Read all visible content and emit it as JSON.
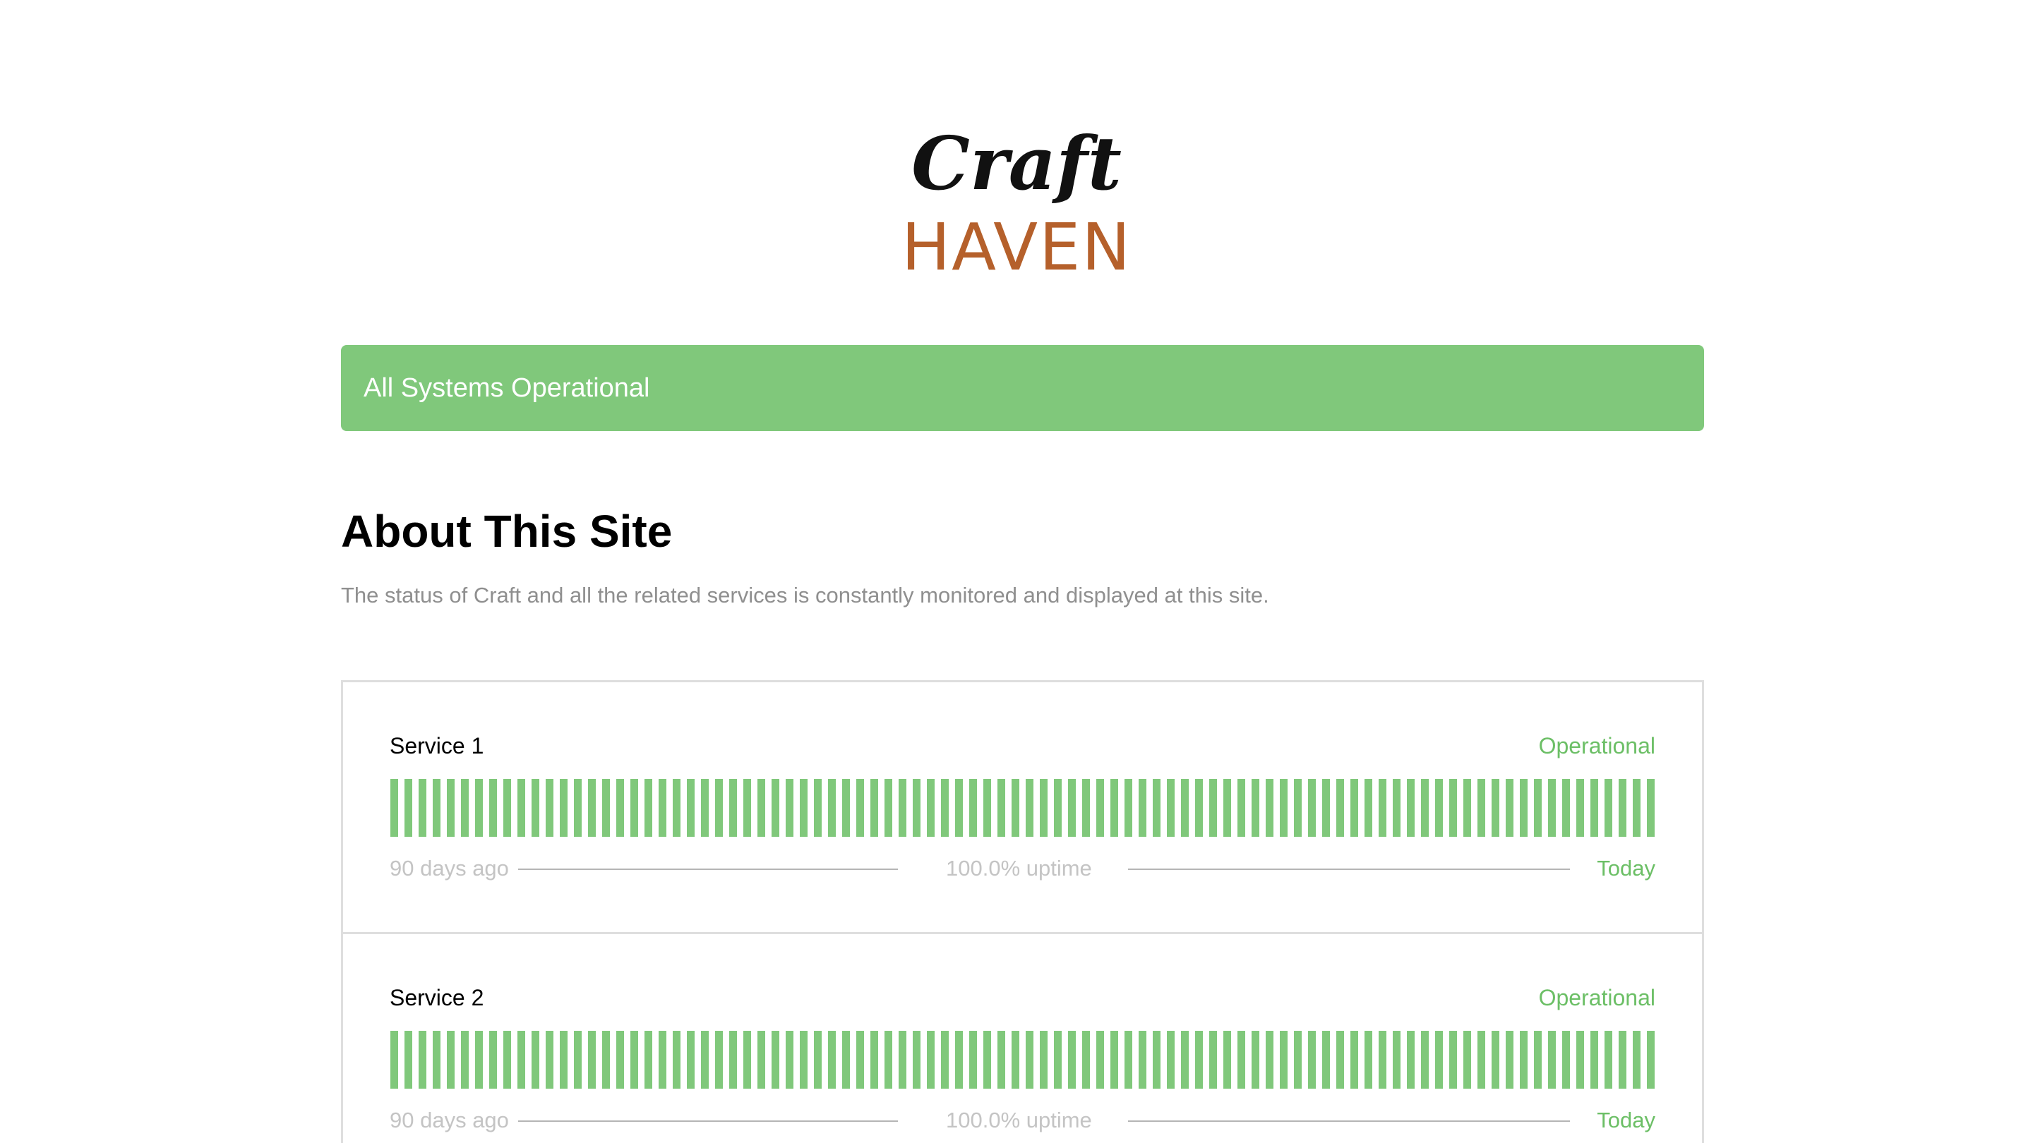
{
  "logo": {
    "line1": "Craft",
    "line2": "HAVEN",
    "colors": {
      "script": "#111111",
      "haven": "#b5602b"
    }
  },
  "status_banner": {
    "text": "All Systems Operational",
    "color": "#80c87b"
  },
  "about": {
    "title": "About This Site",
    "description": "The status of Craft and all the related services is constantly monitored and displayed at this site."
  },
  "services": [
    {
      "name": "Service 1",
      "status": "Operational",
      "start_label": "90 days ago",
      "uptime_label": "100.0% uptime",
      "end_label": "Today",
      "days": 90,
      "uptime_percent": 100.0
    },
    {
      "name": "Service 2",
      "status": "Operational",
      "start_label": "90 days ago",
      "uptime_label": "100.0% uptime",
      "end_label": "Today",
      "days": 90,
      "uptime_percent": 100.0
    }
  ],
  "colors": {
    "operational": "#80c87b",
    "operational_text": "#6cbf66",
    "muted_text": "#c4c4c4",
    "border": "#dedede"
  }
}
